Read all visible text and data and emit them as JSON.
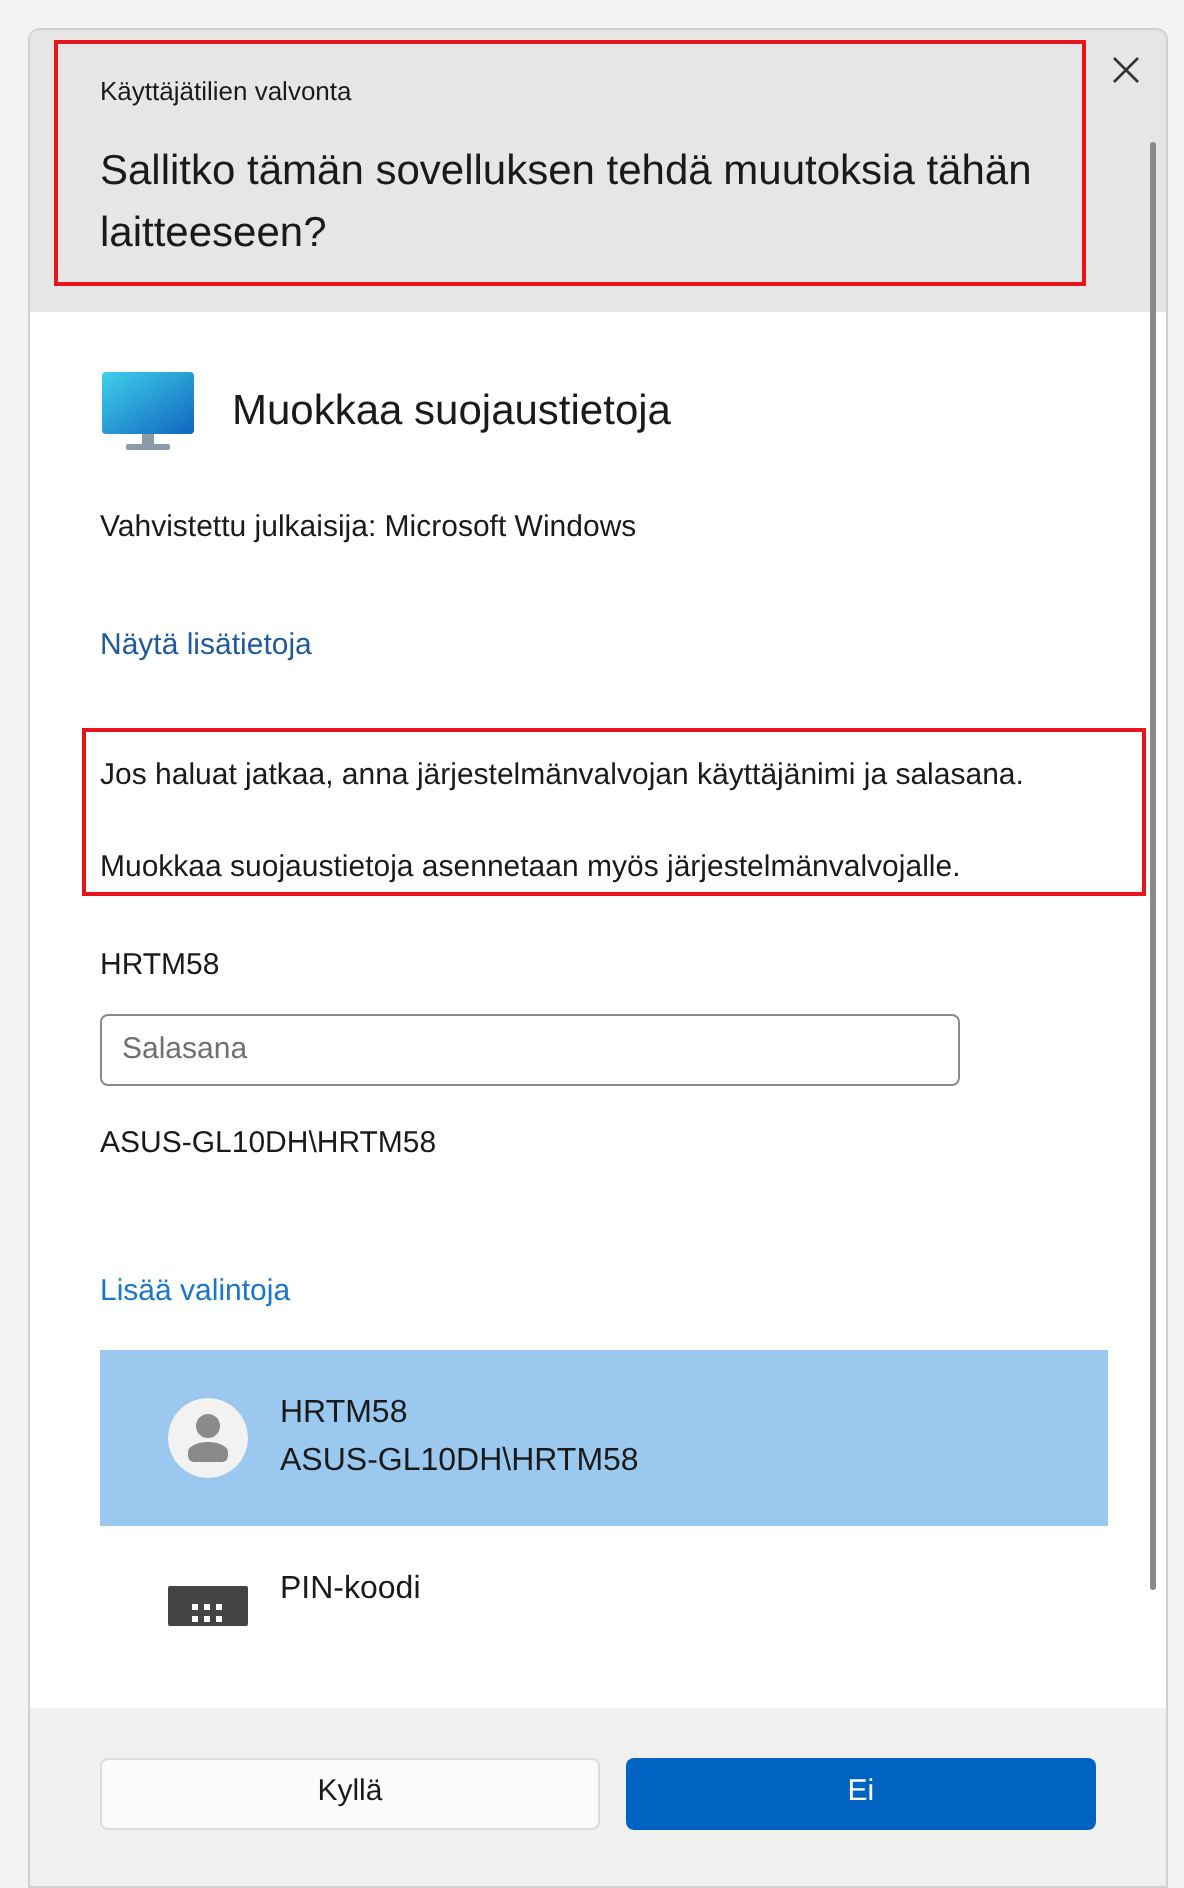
{
  "header": {
    "caption": "Käyttäjätilien valvonta",
    "question": "Sallitko tämän sovelluksen tehdä muutoksia tähän laitteeseen?",
    "highlighted": true
  },
  "app": {
    "name": "Muokkaa suojaustietoja",
    "publisher": "Vahvistettu julkaisija: Microsoft Windows",
    "details_link": "Näytä lisätietoja"
  },
  "message": {
    "paragraphs": [
      "Jos haluat jatkaa, anna järjestelmänvalvojan käyttäjänimi ja salasana.",
      "Muokkaa suojaustietoja asennetaan myös järjestelmänvalvojalle."
    ],
    "highlighted": true
  },
  "user": {
    "name": "HRTM58",
    "password": {
      "placeholder": "Salasana"
    },
    "domain": "ASUS-GL10DH\\HRTM58"
  },
  "more_options": "Lisää valintoja",
  "options": [
    {
      "kind": "account",
      "title": "HRTM58",
      "subtitle": "ASUS-GL10DH\\HRTM58",
      "selected": true
    },
    {
      "kind": "pin",
      "title": "PIN-koodi",
      "selected": false
    }
  ],
  "buttons": [
    {
      "label": "Kyllä",
      "primary": false
    },
    {
      "label": "Ei",
      "primary": true
    }
  ]
}
